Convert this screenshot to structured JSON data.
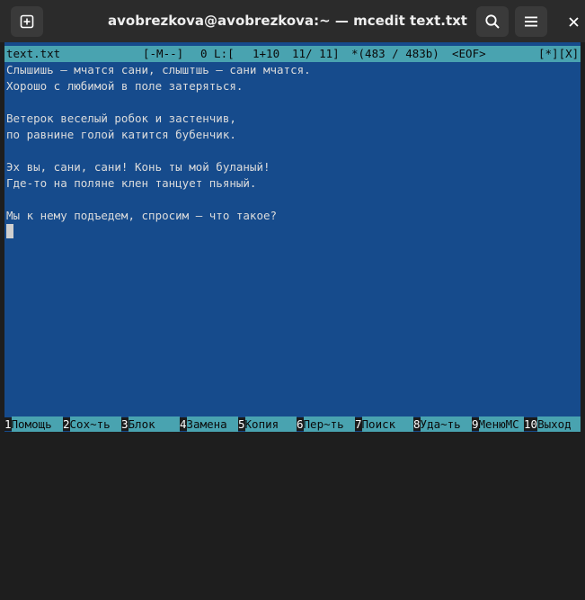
{
  "window": {
    "title": "avobrezkova@avobrezkova:~ — mcedit text.txt",
    "icons": [
      "new-tab-icon",
      "search-icon",
      "menu-icon",
      "close-icon"
    ]
  },
  "status_bar": {
    "filename": "text.txt",
    "mode": "[-M--]",
    "col": "0 L:[",
    "pos": "1+10",
    "lines": "11/ 11]",
    "chars": "*(483 / 483b)",
    "eof": "<EOF>",
    "flags": "[*][X]"
  },
  "editor": {
    "lines": [
      "Слышишь – мчатся сани, слыштшь – сани мчатся.",
      "Хорошо с любимой в поле затеряться.",
      "",
      "Ветерок веселый робок и застенчив,",
      "по равнине голой катится бубенчик.",
      "",
      "Эх вы, сани, сани! Конь ты мой буланый!",
      "Где-то на поляне клен танцует пьяный.",
      "",
      "Мы к нему подъедем, спросим – что такое?"
    ]
  },
  "function_keys": [
    {
      "num": "1",
      "label": "Помощь"
    },
    {
      "num": "2",
      "label": "Сох~ть"
    },
    {
      "num": "3",
      "label": "Блок"
    },
    {
      "num": "4",
      "label": "Замена"
    },
    {
      "num": "5",
      "label": "Копия"
    },
    {
      "num": "6",
      "label": "Пер~ть"
    },
    {
      "num": "7",
      "label": "Поиск"
    },
    {
      "num": "8",
      "label": "Уда~ть"
    },
    {
      "num": "9",
      "label": "МенюMC"
    },
    {
      "num": "10",
      "label": "Выход"
    }
  ],
  "colors": {
    "editor_bg": "#164b8c",
    "status_bg": "#49a3b0",
    "titlebar_bg": "#2b2b2b"
  }
}
